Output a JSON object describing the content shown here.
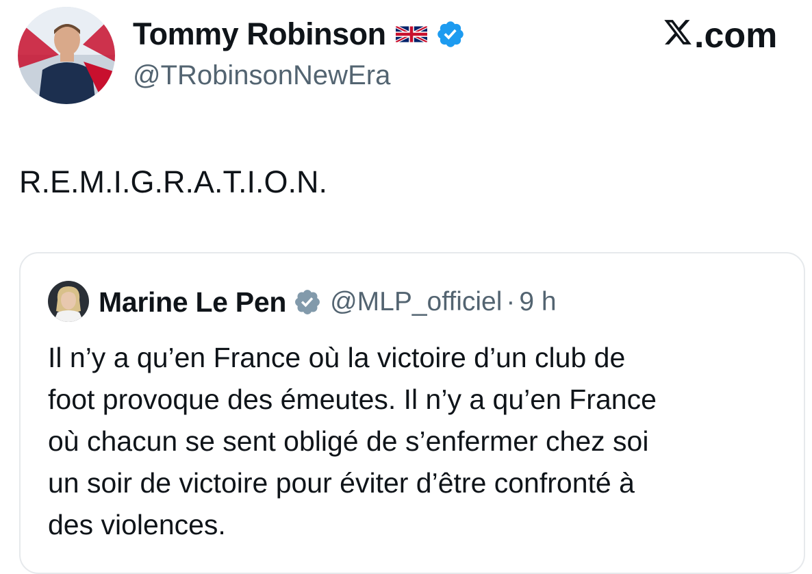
{
  "post": {
    "author": {
      "name": "Tommy Robinson",
      "handle": "@TRobinsonNewEra",
      "flag_icon": "uk-flag-icon",
      "verified_icon": "verified-badge-icon",
      "verified_color": "#1d9bf0"
    },
    "platform_label": ".com",
    "platform_logo_icon": "x-logo-icon",
    "text": "R.E.M.I.G.R.A.T.I.O.N."
  },
  "quote": {
    "author": {
      "name": "Marine Le Pen",
      "handle": "@MLP_officiel",
      "verified_icon": "verified-badge-icon",
      "verified_color": "#829aab"
    },
    "separator": "·",
    "time": "9 h",
    "text_lines": [
      "Il n’y a qu’en France où la victoire d’un club de",
      "foot provoque des émeutes. Il n’y a qu’en France",
      "où chacun se sent obligé de s’enfermer chez soi",
      "un soir de victoire pour éviter d’être confronté à",
      "des violences."
    ]
  },
  "colors": {
    "text_primary": "#0f1419",
    "text_secondary": "#536471",
    "card_border": "#e6e9ec"
  }
}
